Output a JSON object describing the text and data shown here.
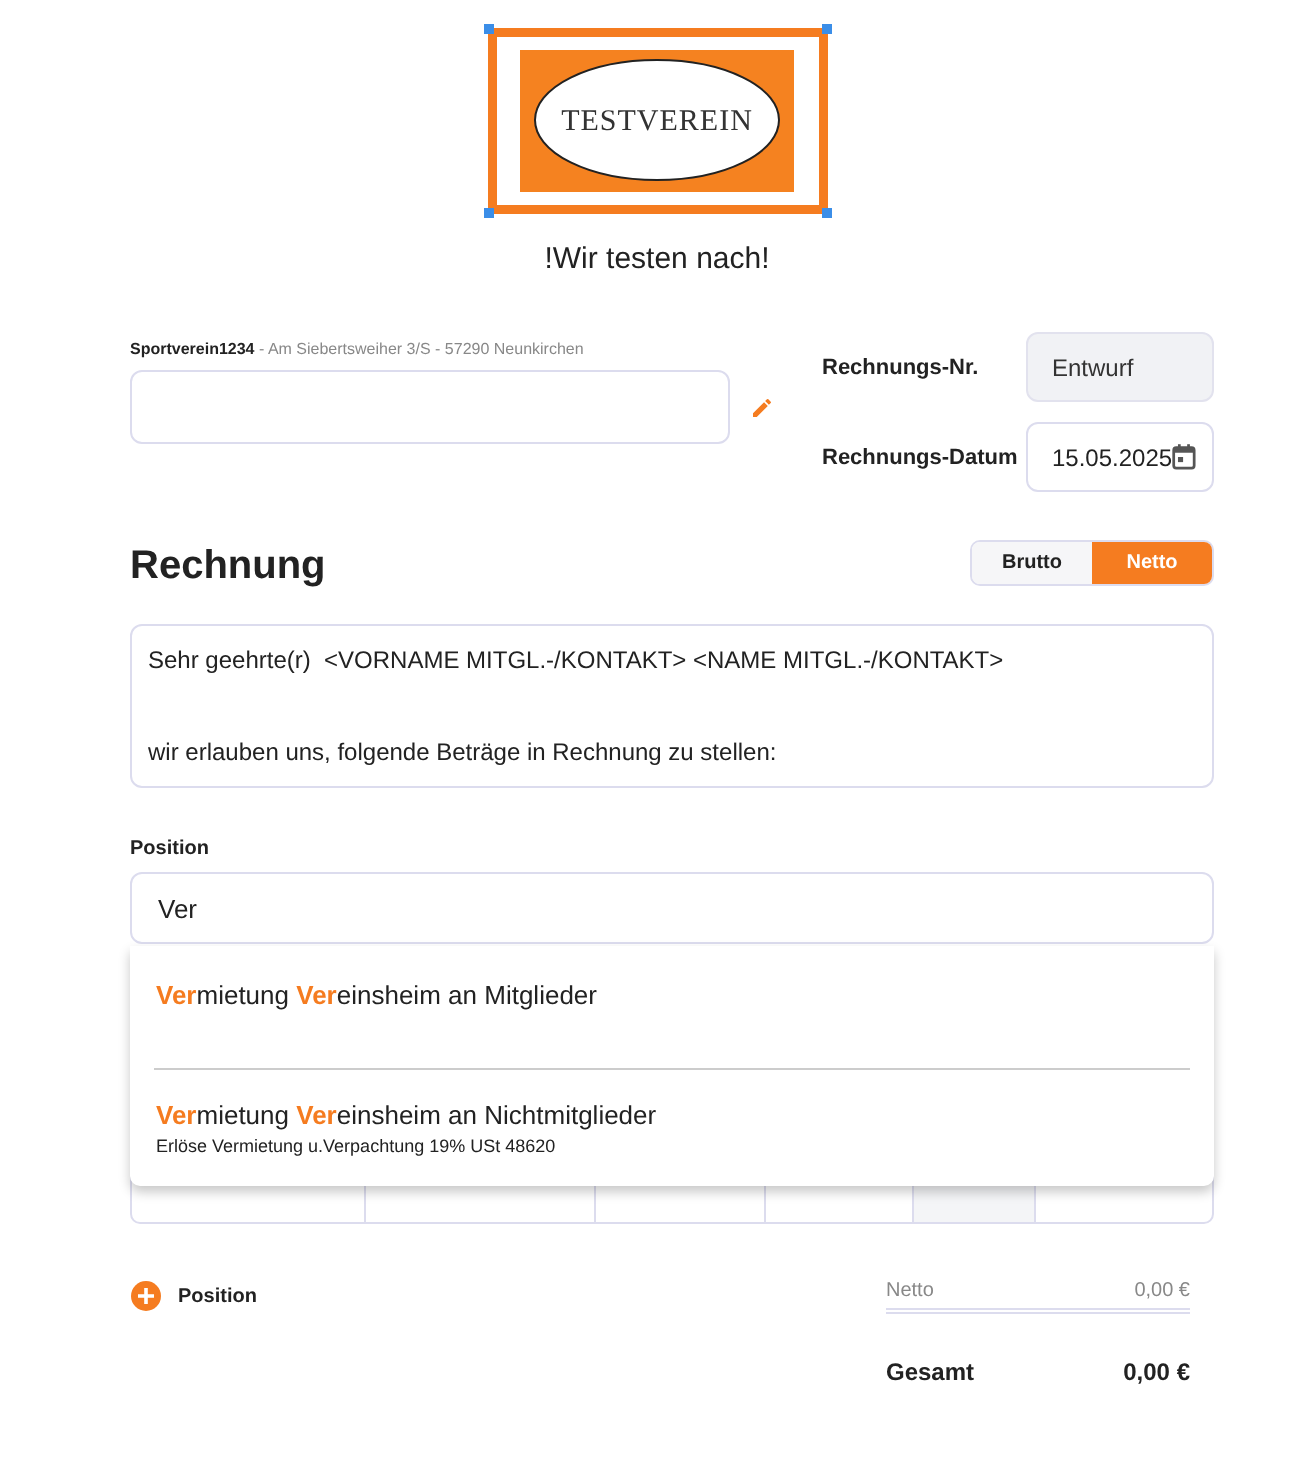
{
  "logo": {
    "text": "TESTVEREIN",
    "selected": true
  },
  "tagline": "!Wir testen nach!",
  "sender": {
    "name": "Sportverein1234",
    "address": "- Am Siebertsweiher 3/S - 57290 Neunkirchen"
  },
  "invoice_number": {
    "label": "Rechnungs-Nr.",
    "value": "Entwurf",
    "disabled": true
  },
  "invoice_date": {
    "label": "Rechnungs-Datum",
    "value": "15.05.2025"
  },
  "title": "Rechnung",
  "mode_toggle": [
    {
      "label": "Brutto",
      "selected": false
    },
    {
      "label": "Netto",
      "selected": true
    }
  ],
  "letter_text": [
    "Sehr geehrte(r)  <VORNAME MITGL.-/KONTAKT> <NAME MITGL.-/KONTAKT>",
    "wir erlauben uns, folgende Beträge in Rechnung zu stellen:"
  ],
  "position": {
    "label": "Position",
    "value": "Ver",
    "suggestions": [
      {
        "title": "Vermietung Vereinsheim an Mitglieder"
      },
      {
        "title": "Vermietung Vereinsheim an Nichtmitglieder",
        "subtitle": "Erlöse Vermietung u.Verpachtung 19% USt 48620"
      }
    ]
  },
  "add_position": "Position",
  "totals": [
    {
      "kind": "net",
      "label": "Netto",
      "value": "0,00 €"
    },
    {
      "kind": "total",
      "label": "Gesamt",
      "value": "0,00 €"
    }
  ]
}
